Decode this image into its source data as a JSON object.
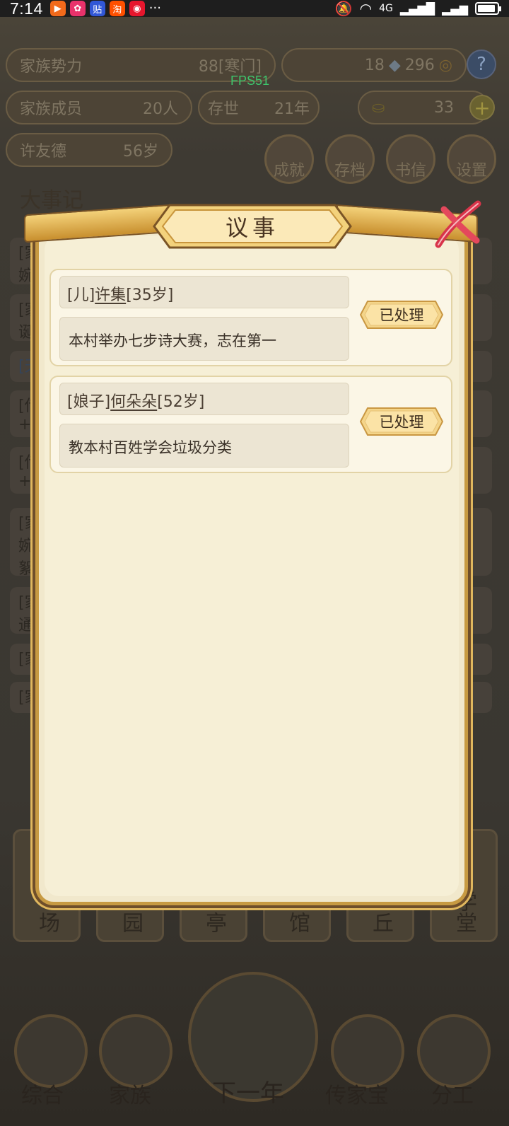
{
  "status_bar": {
    "time": "7:14",
    "more": "···",
    "network": "4G"
  },
  "hud": {
    "family_power_label": "家族势力",
    "family_power_value": "88[寒门]",
    "silver": "18",
    "copper": "296",
    "members_label": "家族成员",
    "members_value": "20人",
    "exist_label": "存世",
    "exist_value": "21年",
    "gold": "33",
    "patriarch_name": "许友德",
    "patriarch_age": "56岁",
    "fps": "FPS51",
    "menu": [
      "成就",
      "存档",
      "书信",
      "设置"
    ]
  },
  "background": {
    "chronicle_title": "大事记",
    "log_rows": [
      "[家",
      "婉",
      "[家",
      "诞",
      "[天",
      "[传",
      "+6",
      "[传",
      "+4",
      "[家",
      "婉",
      "絮",
      "[家",
      "通",
      "[家",
      "[家"
    ],
    "tiles": [
      "场",
      "园",
      "亭",
      "馆",
      "丘",
      "学堂"
    ],
    "nav": [
      "综合",
      "家族",
      "下一年",
      "传家宝",
      "分工"
    ]
  },
  "modal": {
    "title": "议事",
    "items": [
      {
        "relation": "[儿]",
        "name": "许集",
        "age": "[35岁]",
        "task": "本村举办七步诗大赛，志在第一",
        "button": "已处理"
      },
      {
        "relation": "[娘子]",
        "name": "何朵朵",
        "age": "[52岁]",
        "task": "教本村百姓学会垃圾分类",
        "button": "已处理"
      }
    ]
  }
}
